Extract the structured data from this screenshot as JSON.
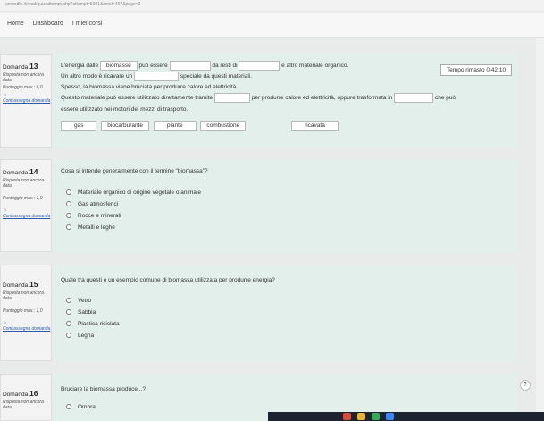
{
  "browser": {
    "url": "amoodle.it/mod/quiz/attempt.php?attempt=5001&cmid=497&page=2"
  },
  "nav": {
    "home": "Home",
    "dashboard": "Dashboard",
    "courses": "I miei corsi"
  },
  "timer": {
    "label": "Tempo rimasto 0:42:10"
  },
  "questions": [
    {
      "label": "Domanda",
      "number": "13",
      "status": "Risposta non ancora data",
      "score": "Punteggio max.: 6,0",
      "flag": "Contrassegna domanda",
      "lines": {
        "l1a": "L'energia dalle",
        "l1b": "biomasse",
        "l1c": "può essere",
        "l1d": "da resti di",
        "l1e": "e altro materiale organico.",
        "l2a": "Un altro modo è ricavare un",
        "l2b": "speciale da questi materiali.",
        "l3": "Spesso, la biomassa viene bruciata per produrre calore ed elettricità.",
        "l4a": "Questo materiale può essere utilizzato direttamente tramite",
        "l4b": "per produrre calore ed elettricità, oppure trasformata in",
        "l4c": "che può",
        "l5": "essere utilizzato nei motori dei mezzi di trasporto."
      },
      "words": [
        "gas",
        "biocarburante",
        "piante",
        "combustione",
        "ricavata"
      ]
    },
    {
      "label": "Domanda",
      "number": "14",
      "status": "Risposta non ancora data",
      "score": "Punteggio max.: 1,0",
      "flag": "Contrassegna domanda",
      "text": "Cosa si intende generalmente con il termine \"biomassa\"?",
      "options": [
        "Materiale organico di origine vegetale o animale",
        "Gas atmosferici",
        "Rocce e minerali",
        "Metalli e leghe"
      ]
    },
    {
      "label": "Domanda",
      "number": "15",
      "status": "Risposta non ancora data",
      "score": "Punteggio max.: 1,0",
      "flag": "Contrassegna domanda",
      "text": "Quale tra questi è un esempio comune di biomassa utilizzata per produrre energia?",
      "options": [
        "Vetro",
        "Sabbia",
        "Plastica riciclata",
        "Legna"
      ]
    },
    {
      "label": "Domanda",
      "number": "16",
      "status": "Risposta non ancora data",
      "text": "Bruciare la biomassa produce...?",
      "options": [
        "Ombra"
      ]
    }
  ],
  "help": {
    "label": "?"
  }
}
